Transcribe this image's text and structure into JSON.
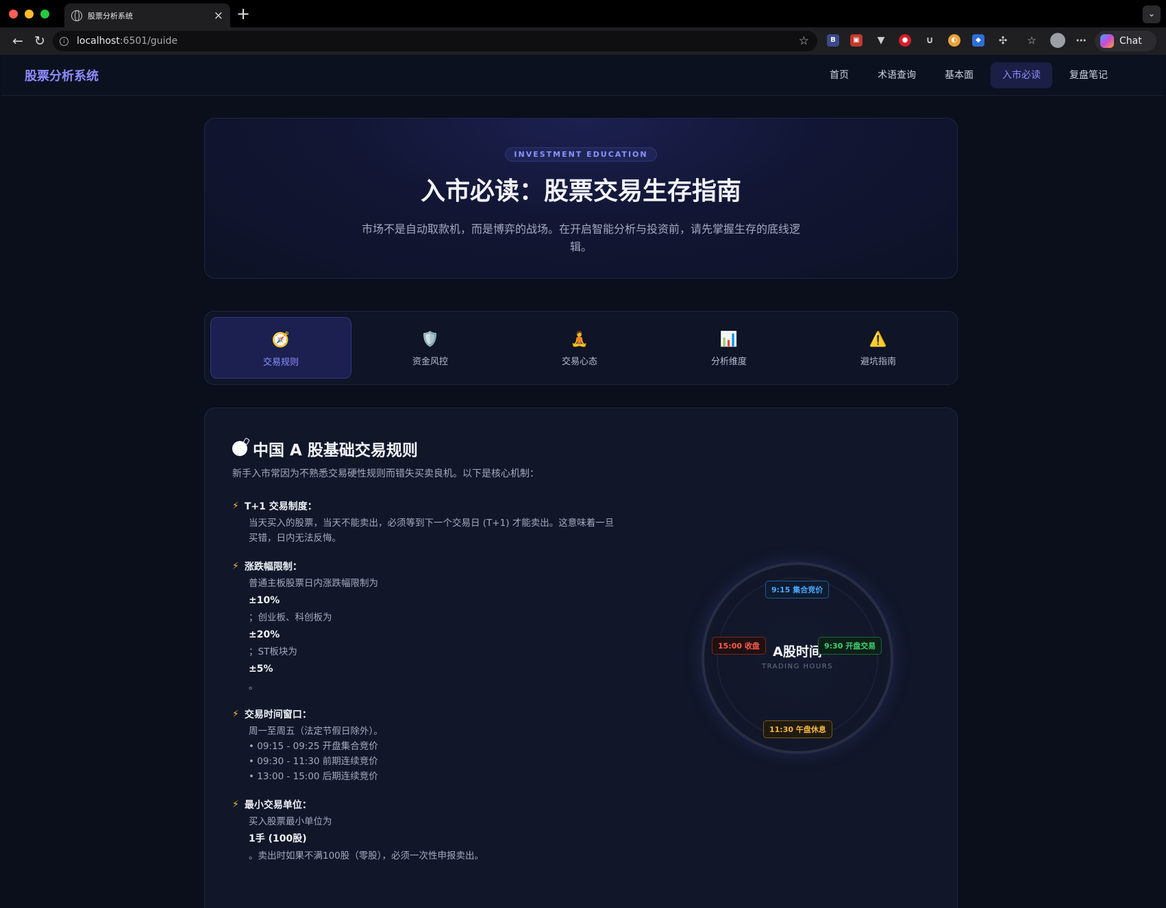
{
  "browser": {
    "tab_title": "股票分析系统",
    "url_host": "localhost",
    "url_path": ":6501/guide",
    "chat_label": "Chat"
  },
  "app": {
    "brand": "股票分析系统",
    "nav": [
      {
        "label": "首页",
        "active": false
      },
      {
        "label": "术语查询",
        "active": false
      },
      {
        "label": "基本面",
        "active": false
      },
      {
        "label": "入市必读",
        "active": true
      },
      {
        "label": "复盘笔记",
        "active": false
      }
    ]
  },
  "hero": {
    "badge": "INVESTMENT EDUCATION",
    "title": "入市必读：股票交易生存指南",
    "subtitle": "市场不是自动取款机，而是博弈的战场。在开启智能分析与投资前，请先掌握生存的底线逻辑。"
  },
  "guide_tabs": [
    {
      "icon": "compass-icon",
      "glyph": "🧭",
      "label": "交易规则",
      "active": true
    },
    {
      "icon": "shield-icon",
      "glyph": "🛡️",
      "label": "资金风控",
      "active": false
    },
    {
      "icon": "meditation-icon",
      "glyph": "🧘",
      "label": "交易心态",
      "active": false
    },
    {
      "icon": "bar-chart-icon",
      "glyph": "📊",
      "label": "分析维度",
      "active": false
    },
    {
      "icon": "warning-icon",
      "glyph": "⚠️",
      "label": "避坑指南",
      "active": false
    }
  ],
  "section": {
    "title": "中国 A 股基础交易规则",
    "intro": "新手入市常因为不熟悉交易硬性规则而错失买卖良机。以下是核心机制：",
    "rules": [
      {
        "title": "T+1 交易制度：",
        "lines": [
          "当天买入的股票，当天不能卖出，必须等到下一个交易日 (T+1) 才能卖出。这意味着一旦",
          "买错，日内无法反悔。"
        ]
      },
      {
        "title": "涨跌幅限制：",
        "parts": [
          {
            "text": "普通主板股票日内涨跌幅限制为"
          },
          {
            "bold": "±10%"
          },
          {
            "text": "；创业板、科创板为"
          },
          {
            "bold": "±20%"
          },
          {
            "text": "；ST板块为"
          },
          {
            "bold": "±5%"
          },
          {
            "text": "。"
          }
        ]
      },
      {
        "title": "交易时间窗口：",
        "lines": [
          "周一至周五（法定节假日除外）。",
          "• 09:15 - 09:25 开盘集合竞价",
          "• 09:30 - 11:30 前期连续竞价",
          "• 13:00 - 15:00 后期连续竞价"
        ]
      },
      {
        "title": "最小交易单位：",
        "parts": [
          {
            "text": "买入股票最小单位为"
          },
          {
            "bold": "1手 (100股)"
          },
          {
            "text": "。卖出时如果不满100股（零股），必须一次性申报卖出。"
          }
        ]
      }
    ]
  },
  "clock": {
    "title": "A股时间",
    "subtitle": "TRADING HOURS",
    "marks": {
      "top": "9:15 集合竞价",
      "right": "9:30 开盘交易",
      "bottom": "11:30 午盘休息",
      "left": "15:00 收盘"
    },
    "colors": {
      "top": "#4aa7ff",
      "right": "#3cd36f",
      "bottom": "#f6b73c",
      "left": "#ff5a4d"
    }
  }
}
